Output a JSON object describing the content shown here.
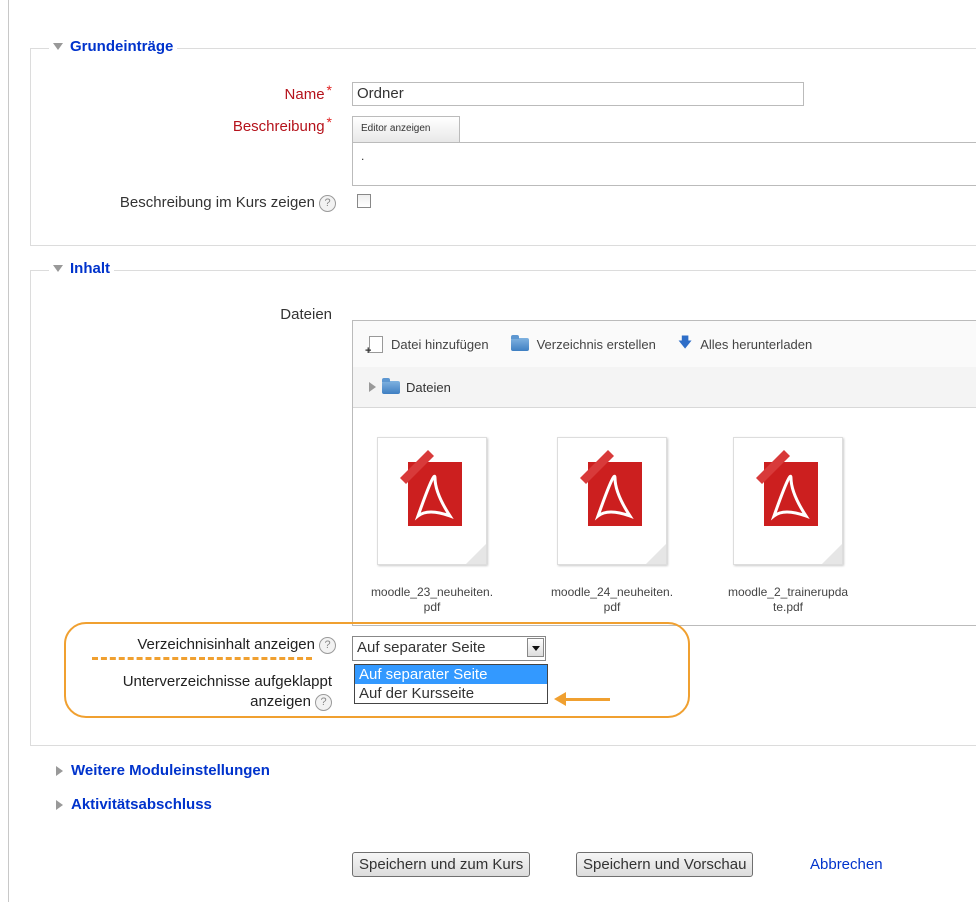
{
  "general": {
    "legend": "Grundeinträge",
    "name_label": "Name",
    "required_mark": "*",
    "name_value": "Ordner",
    "description_label": "Beschreibung",
    "editor_button": "Editor anzeigen",
    "description_value": ".",
    "show_description_label": "Beschreibung im Kurs zeigen",
    "help_glyph": "?"
  },
  "content": {
    "legend": "Inhalt",
    "files_label": "Dateien",
    "toolbar": {
      "add_file": "Datei hinzufügen",
      "create_folder": "Verzeichnis erstellen",
      "download_all": "Alles herunterladen"
    },
    "path_root": "Dateien",
    "files": [
      {
        "name": "moodle_23_neuheiten.\npdf",
        "icon": "pdf-icon"
      },
      {
        "name": "moodle_24_neuheiten.\npdf",
        "icon": "pdf-icon"
      },
      {
        "name": "moodle_2_trainerupda\nte.pdf",
        "icon": "pdf-icon"
      }
    ],
    "display_label": "Verzeichnisinhalt anzeigen",
    "display_selected": "Auf separater Seite",
    "display_options": [
      "Auf separater Seite",
      "Auf der Kursseite"
    ],
    "subfolders_label_line1": "Unterverzeichnisse aufgeklappt",
    "subfolders_label_line2": "anzeigen"
  },
  "sections": {
    "more_settings": "Weitere Moduleinstellungen",
    "completion": "Aktivitätsabschluss"
  },
  "buttons": {
    "save_return": "Speichern und zum Kurs",
    "save_display": "Speichern und Vorschau",
    "cancel": "Abbrechen"
  },
  "colors": {
    "legend": "#0033cc",
    "required": "#b5121b",
    "highlight": "#f0a030",
    "selected_option": "#3399ff"
  }
}
